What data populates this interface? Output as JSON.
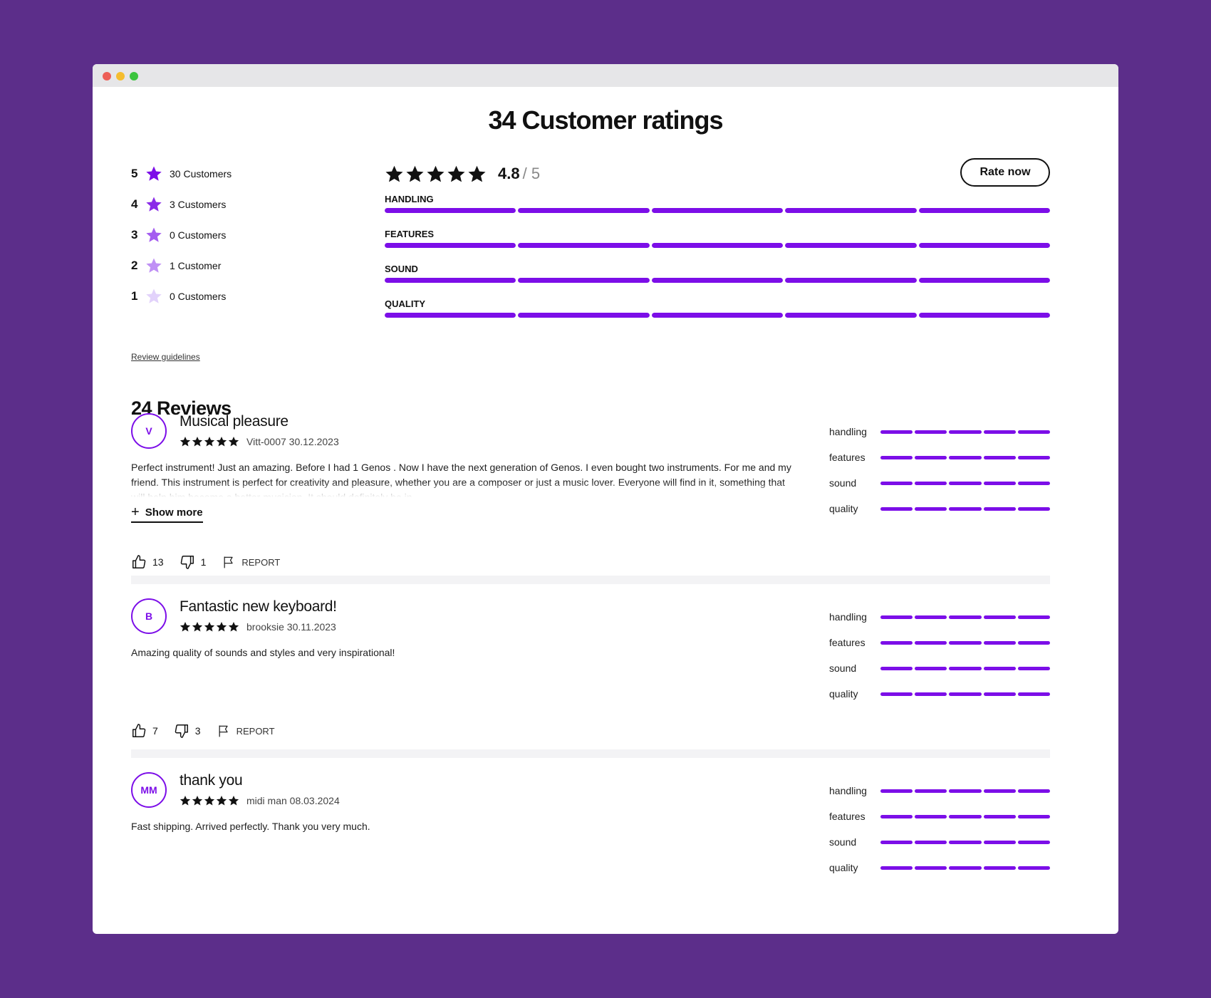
{
  "page": {
    "title": "34 Customer ratings"
  },
  "distribution": [
    {
      "stars": "5",
      "count": "30 Customers",
      "color": "#7c0ee8"
    },
    {
      "stars": "4",
      "count": "3 Customers",
      "color": "#8a2be8"
    },
    {
      "stars": "3",
      "count": "0 Customers",
      "color": "#a45cf0"
    },
    {
      "stars": "2",
      "count": "1 Customer",
      "color": "#bf8ff5"
    },
    {
      "stars": "1",
      "count": "0 Customers",
      "color": "#e2d2fb"
    }
  ],
  "overall": {
    "average": "4.8",
    "max": "/ 5",
    "star_fill": 4.8,
    "rate_button": "Rate now",
    "criteria": [
      {
        "label": "HANDLING",
        "score": 5
      },
      {
        "label": "FEATURES",
        "score": 5
      },
      {
        "label": "SOUND",
        "score": 5
      },
      {
        "label": "QUALITY",
        "score": 5
      }
    ]
  },
  "guidelines_link": "Review guidelines",
  "reviews_heading": "24 Reviews",
  "show_more_label": "Show more",
  "report_label": "REPORT",
  "accent_color": "#7c0ee8",
  "reviews": [
    {
      "initials": "V",
      "title": "Musical pleasure",
      "author_date": "Vitt-0007 30.12.2023",
      "rating": 5,
      "body": "Perfect instrument! Just an amazing. Before I had 1 Genos . Now I have the next generation of Genos. I even bought two instruments. For me and my friend. This instrument is perfect for creativity and pleasure, whether you are a composer or just a music lover. Everyone will find in it, something that will help him become a better musician. It should definitely be in",
      "truncated": true,
      "likes": "13",
      "dislikes": "1",
      "sub_ratings": [
        {
          "label": "handling",
          "score": 5
        },
        {
          "label": "features",
          "score": 5
        },
        {
          "label": "sound",
          "score": 5
        },
        {
          "label": "quality",
          "score": 5
        }
      ]
    },
    {
      "initials": "B",
      "title": "Fantastic new keyboard!",
      "author_date": "brooksie 30.11.2023",
      "rating": 5,
      "body": "Amazing quality of sounds and styles and very inspirational!",
      "truncated": false,
      "likes": "7",
      "dislikes": "3",
      "sub_ratings": [
        {
          "label": "handling",
          "score": 5
        },
        {
          "label": "features",
          "score": 5
        },
        {
          "label": "sound",
          "score": 5
        },
        {
          "label": "quality",
          "score": 5
        }
      ]
    },
    {
      "initials": "MM",
      "title": "thank you",
      "author_date": "midi man 08.03.2024",
      "rating": 5,
      "body": "Fast shipping. Arrived perfectly. Thank you very much.",
      "truncated": false,
      "likes": "",
      "dislikes": "",
      "sub_ratings": [
        {
          "label": "handling",
          "score": 5
        },
        {
          "label": "features",
          "score": 5
        },
        {
          "label": "sound",
          "score": 5
        },
        {
          "label": "quality",
          "score": 5
        }
      ]
    }
  ]
}
